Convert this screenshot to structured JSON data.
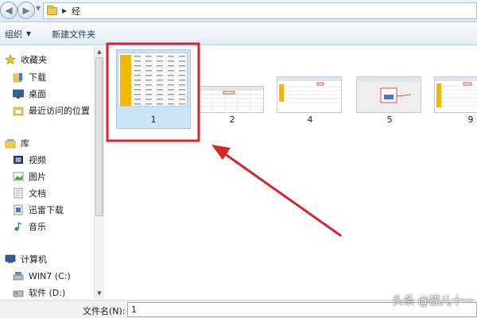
{
  "address": {
    "path_segment": "经"
  },
  "toolbar": {
    "organize_label": "组织",
    "new_folder_label": "新建文件夹"
  },
  "sidebar": {
    "favorites": {
      "label": "收藏夹",
      "items": [
        {
          "label": "下载",
          "icon": "download-folder-icon"
        },
        {
          "label": "桌面",
          "icon": "desktop-icon"
        },
        {
          "label": "最近访问的位置",
          "icon": "recent-places-icon"
        }
      ]
    },
    "libraries": {
      "label": "库",
      "items": [
        {
          "label": "视频",
          "icon": "video-icon"
        },
        {
          "label": "图片",
          "icon": "picture-icon"
        },
        {
          "label": "文档",
          "icon": "document-icon"
        },
        {
          "label": "迅雷下载",
          "icon": "thunder-download-icon"
        },
        {
          "label": "音乐",
          "icon": "music-icon"
        }
      ]
    },
    "computer": {
      "label": "计算机",
      "items": [
        {
          "label": "WIN7 (C:)",
          "icon": "drive-icon"
        },
        {
          "label": "软件 (D:)",
          "icon": "drive-icon"
        }
      ]
    }
  },
  "files": [
    {
      "name": "1",
      "selected": true
    },
    {
      "name": "2",
      "selected": false
    },
    {
      "name": "4",
      "selected": false
    },
    {
      "name": "5",
      "selected": false
    },
    {
      "name": "9",
      "selected": false
    }
  ],
  "file_name_field": {
    "label": "文件名(N):",
    "value": "1"
  },
  "watermark": "头条 @猫儿十一",
  "colors": {
    "highlight_red": "#d9232a",
    "selection_blue": "#cce4f7",
    "spreadsheet_yellow": "#f2b705"
  }
}
